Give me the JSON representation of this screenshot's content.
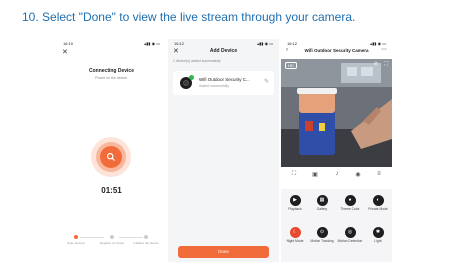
{
  "instruction": "10. Select \"Done\" to view the live stream through your camera.",
  "screen1": {
    "time": "16:10",
    "status_icons": "▴▮▮ ◉ ▭",
    "close": "✕",
    "title": "Connecting Device",
    "subtitle": "Power on the device.",
    "timer": "01:51",
    "steps": [
      "Scan devices",
      "Register on Cloud",
      "Initialize the device"
    ]
  },
  "screen2": {
    "time": "16:12",
    "close": "✕",
    "title": "Add Device",
    "subtitle": "1 device(s) added successfully",
    "device_name": "Wifi Outdoor Security C...",
    "device_status": "Added successfully",
    "done_label": "Done"
  },
  "screen3": {
    "time": "16:12",
    "title": "Wifi Outdoor Security Camera",
    "hd_badge": "HD",
    "back": "‹",
    "more": "⋯",
    "features": [
      {
        "label": "Playback",
        "icon": "playback-icon"
      },
      {
        "label": "Gallery",
        "icon": "gallery-icon"
      },
      {
        "label": "Theme Color",
        "icon": "palette-icon"
      },
      {
        "label": "Private Mode",
        "icon": "private-mode-icon"
      },
      {
        "label": "Night Mode",
        "icon": "night-mode-icon"
      },
      {
        "label": "Motion Tracking",
        "icon": "motion-tracking-icon"
      },
      {
        "label": "Motion Detection",
        "icon": "motion-detection-icon"
      },
      {
        "label": "Light",
        "icon": "light-icon"
      }
    ]
  },
  "colors": {
    "title": "#1f6fb0",
    "accent": "#f26b3a",
    "success": "#2db84c"
  }
}
